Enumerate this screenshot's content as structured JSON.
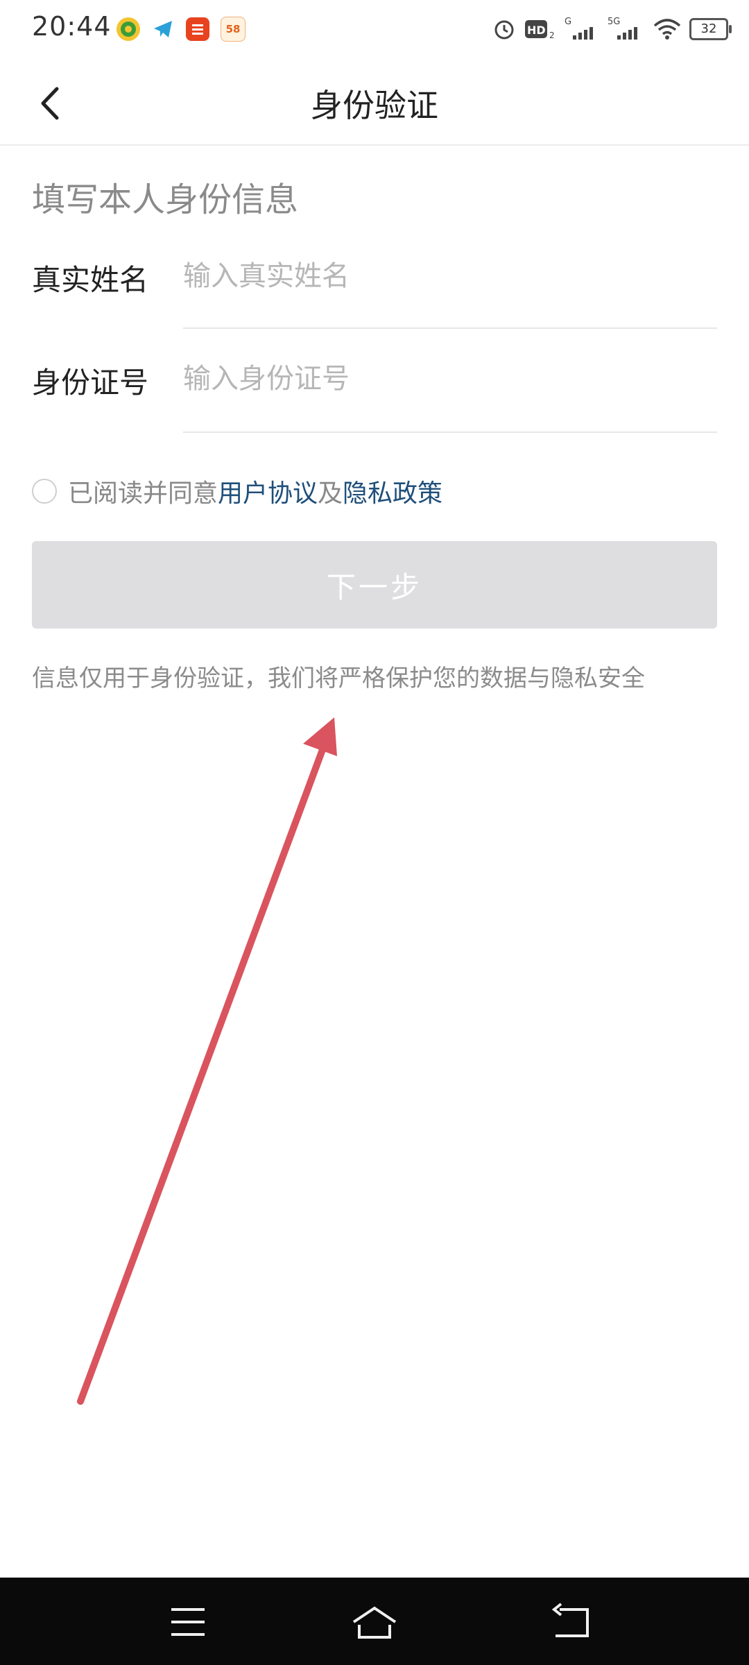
{
  "status": {
    "time": "20:44",
    "network_hd": "HD",
    "network_1": "G",
    "network_2": "5G",
    "battery": "32",
    "app_icons": [
      "bank-app-icon",
      "telegram-icon",
      "pingan-bank-icon",
      "58-app-icon"
    ]
  },
  "header": {
    "title": "身份验证"
  },
  "form": {
    "section_title": "填写本人身份信息",
    "name_label": "真实姓名",
    "name_placeholder": "输入真实姓名",
    "id_label": "身份证号",
    "id_placeholder": "输入身份证号",
    "agree_prefix": "已阅读并同意",
    "agreement_link": "用户协议",
    "and": "及",
    "privacy_link": "隐私政策",
    "next_button": "下一步",
    "note": "信息仅用于身份验证，我们将严格保护您的数据与隐私安全"
  },
  "colors": {
    "link": "#1f4f7a",
    "button_disabled": "#dedee0",
    "annotation_arrow": "#d9545e"
  }
}
